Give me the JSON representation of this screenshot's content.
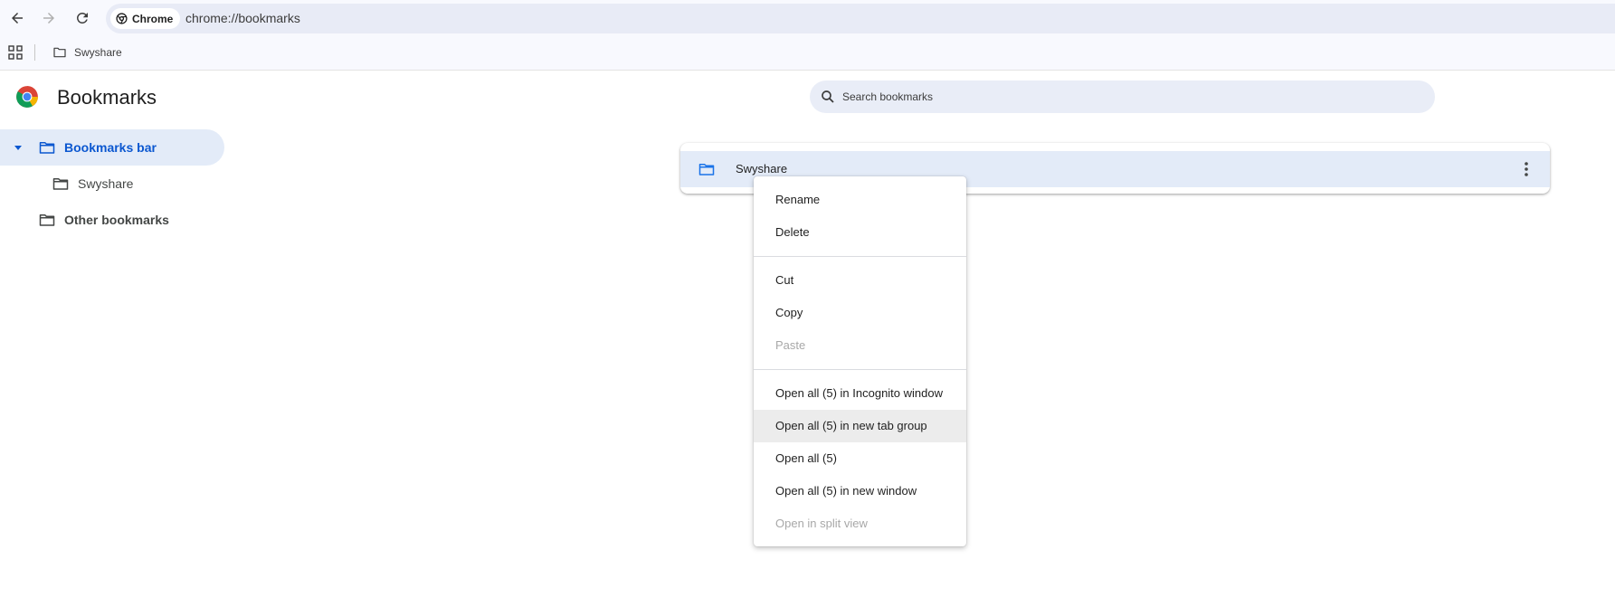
{
  "browser": {
    "chip_label": "Chrome",
    "url": "chrome://bookmarks"
  },
  "bookmarks_bar": {
    "items": [
      {
        "label": "Swyshare"
      }
    ]
  },
  "header": {
    "title": "Bookmarks",
    "search_placeholder": "Search bookmarks"
  },
  "sidebar": {
    "items": [
      {
        "label": "Bookmarks bar",
        "selected": true
      },
      {
        "label": "Swyshare"
      },
      {
        "label": "Other bookmarks"
      }
    ]
  },
  "list": {
    "rows": [
      {
        "name": "Swyshare",
        "type": "folder"
      }
    ]
  },
  "context_menu": {
    "items": [
      {
        "label": "Rename",
        "enabled": true
      },
      {
        "label": "Delete",
        "enabled": true
      },
      {
        "label": "Cut",
        "enabled": true
      },
      {
        "label": "Copy",
        "enabled": true
      },
      {
        "label": "Paste",
        "enabled": false
      },
      {
        "label": "Open all (5) in Incognito window",
        "enabled": true
      },
      {
        "label": "Open all (5) in new tab group",
        "enabled": true,
        "hovered": true
      },
      {
        "label": "Open all (5)",
        "enabled": true
      },
      {
        "label": "Open all (5) in new window",
        "enabled": true
      },
      {
        "label": "Open in split view",
        "enabled": false
      }
    ]
  },
  "colors": {
    "accent": "#0b57d0",
    "selection_bg": "#e3ebf8",
    "folder_blue": "#1a73e8"
  }
}
